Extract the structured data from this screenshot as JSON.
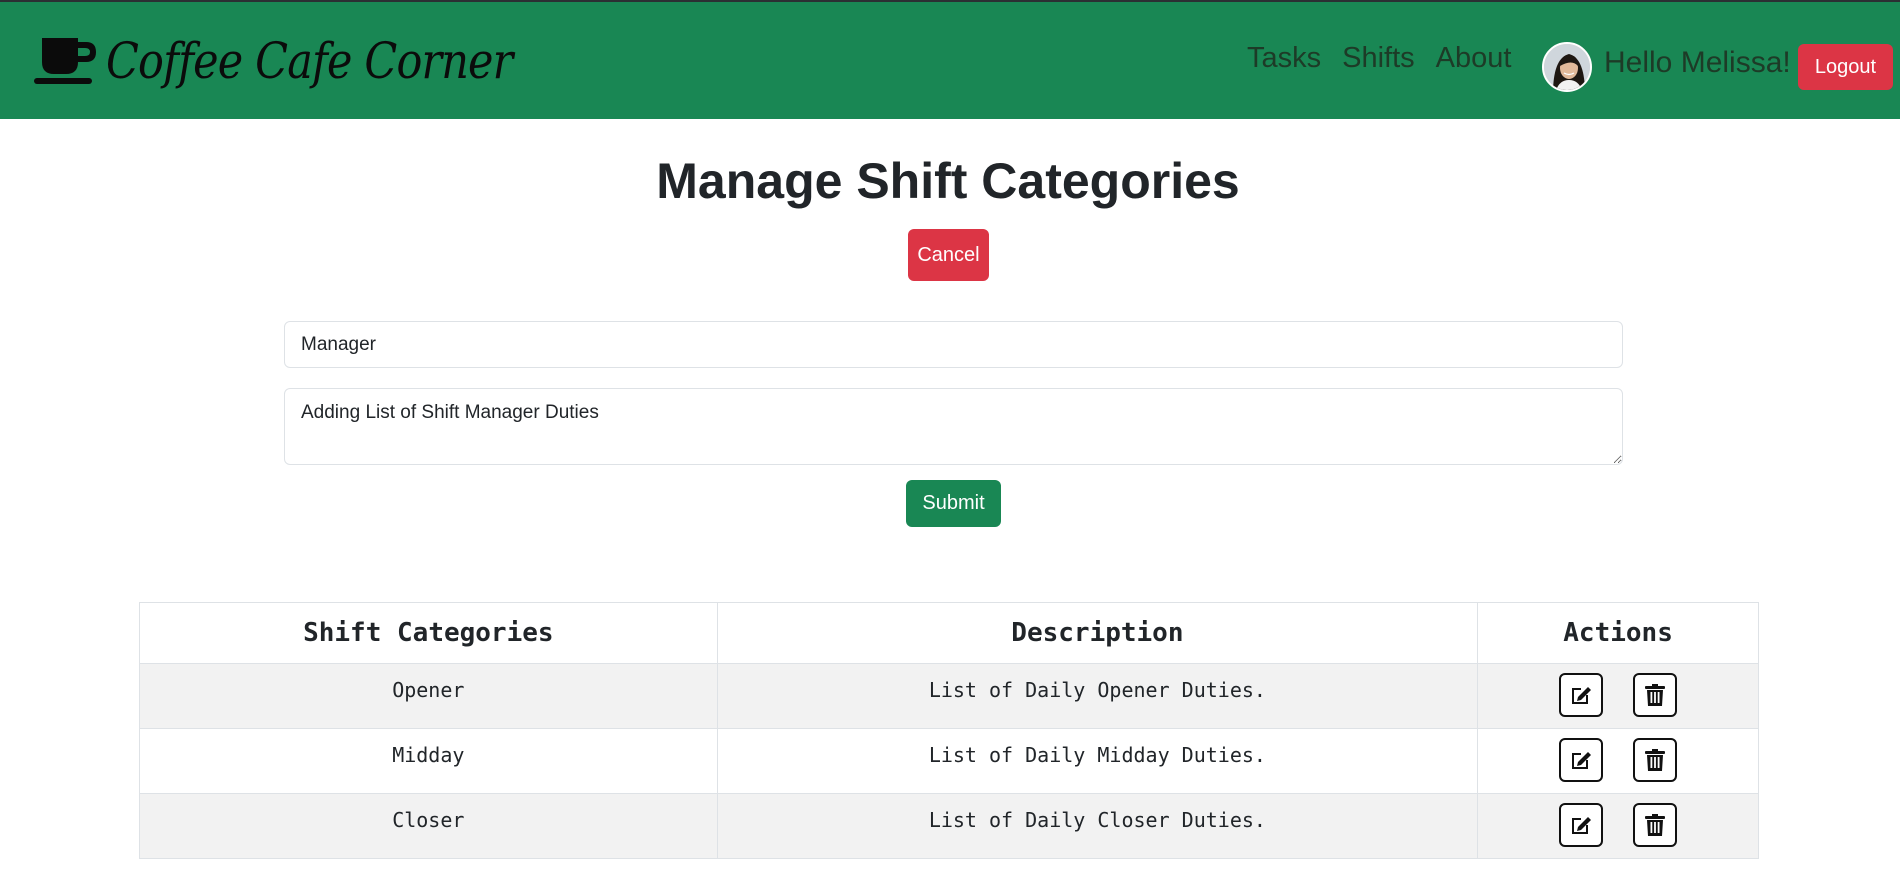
{
  "navbar": {
    "brand": "Coffee Cafe Corner",
    "brand_icon": "coffee-cup-icon",
    "links": [
      "Tasks",
      "Shifts",
      "About"
    ],
    "greeting": "Hello Melissa!",
    "logout_label": "Logout",
    "color": "#198754"
  },
  "page": {
    "title": "Manage Shift Categories",
    "cancel_label": "Cancel",
    "submit_label": "Submit"
  },
  "form": {
    "name_value": "Manager",
    "description_value": "Adding List of Shift Manager Duties"
  },
  "table": {
    "headers": [
      "Shift Categories",
      "Description",
      "Actions"
    ],
    "rows": [
      {
        "category": "Opener",
        "description": "List of Daily Opener Duties."
      },
      {
        "category": "Midday",
        "description": "List of Daily Midday Duties."
      },
      {
        "category": "Closer",
        "description": "List of Daily Closer Duties."
      }
    ],
    "action_icons": [
      "edit-icon",
      "trash-icon"
    ]
  },
  "colors": {
    "danger": "#dc3545",
    "success": "#198754"
  }
}
